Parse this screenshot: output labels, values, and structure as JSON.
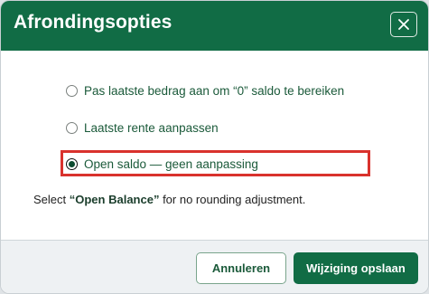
{
  "dialog": {
    "title": "Afrondingsopties",
    "close_icon": "close-icon"
  },
  "options": [
    {
      "label": "Pas laatste bedrag aan om “0” saldo te bereiken",
      "selected": false
    },
    {
      "label": "Laatste rente aanpassen",
      "selected": false
    },
    {
      "label": "Open saldo — geen aanpassing",
      "selected": true
    }
  ],
  "hint": {
    "prefix": "Select ",
    "emphasis": "“Open Balance”",
    "suffix": " for no rounding adjustment."
  },
  "footer": {
    "cancel_label": "Annuleren",
    "save_label": "Wijziging opslaan"
  },
  "colors": {
    "brand": "#116c45",
    "highlight": "#d9322d"
  }
}
